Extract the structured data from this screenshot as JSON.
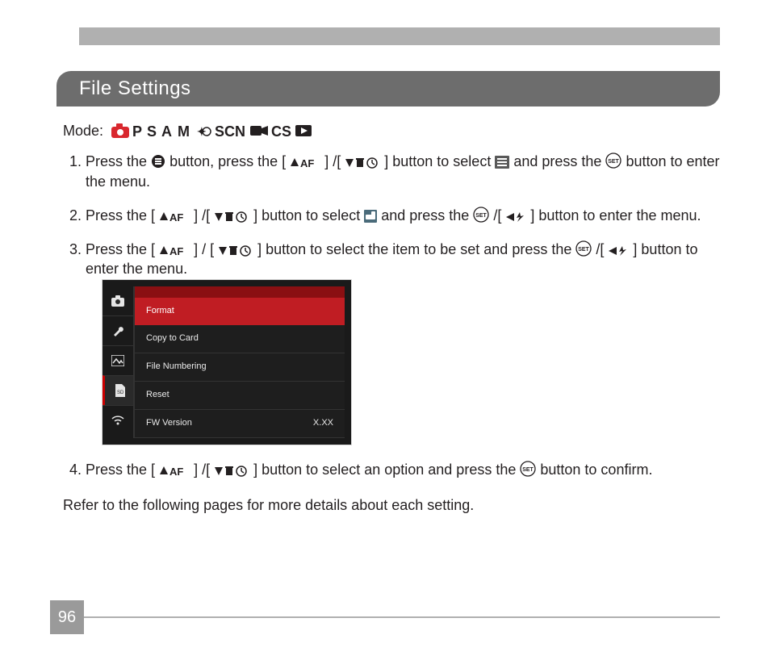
{
  "header": {
    "title": "File Settings"
  },
  "mode": {
    "label": "Mode:"
  },
  "steps": {
    "s1a": "Press the ",
    "s1b": " button, press the [",
    "s1c": "] /[",
    "s1d": "] button to select ",
    "s1e": " and press the ",
    "s1f": " button to enter the menu.",
    "s2a": "Press the [",
    "s2b": "] /[",
    "s2c": "] button to select ",
    "s2d": " and press the ",
    "s2e": " /[",
    "s2f": "] button to enter the menu.",
    "s3a": "Press the [",
    "s3b": "] / [",
    "s3c": "] button to select the item to be set and press the ",
    "s3d": " /[",
    "s3e": "] button to enter the menu.",
    "s4a": "Press the [",
    "s4b": "] /[",
    "s4c": "] button to select an option and press the ",
    "s4d": " button to confirm."
  },
  "menu": {
    "items": [
      {
        "label": "Format",
        "value": ""
      },
      {
        "label": "Copy to Card",
        "value": ""
      },
      {
        "label": "File Numbering",
        "value": ""
      },
      {
        "label": "Reset",
        "value": ""
      },
      {
        "label": "FW Version",
        "value": "X.XX"
      }
    ]
  },
  "closing": "Refer to the following pages for more details about each setting.",
  "page_number": "96"
}
